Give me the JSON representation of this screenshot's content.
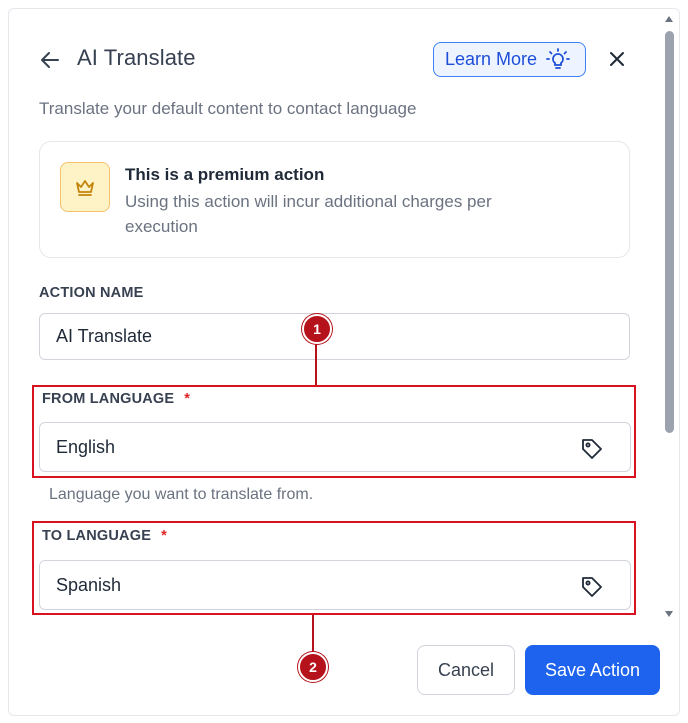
{
  "header": {
    "title": "AI Translate",
    "learn_more_label": "Learn More"
  },
  "subtitle": "Translate your default content to contact language",
  "premium": {
    "title": "This is a premium action",
    "description": "Using this action will incur additional charges per execution"
  },
  "fields": {
    "action_name": {
      "label": "ACTION NAME",
      "value": "AI Translate"
    },
    "from_language": {
      "label": "FROM LANGUAGE",
      "required_mark": "*",
      "value": "English",
      "help": "Language you want to translate from."
    },
    "to_language": {
      "label": "TO LANGUAGE",
      "required_mark": "*",
      "value": "Spanish"
    }
  },
  "annotations": {
    "badge_1": "1",
    "badge_2": "2"
  },
  "footer": {
    "cancel_label": "Cancel",
    "save_label": "Save Action"
  },
  "colors": {
    "primary": "#1d63ed",
    "annotation": "#d9121f",
    "premium_bg": "#fef3c7"
  },
  "icons": [
    "arrow-left-icon",
    "lightbulb-icon",
    "close-icon",
    "crown-icon",
    "tag-icon"
  ]
}
